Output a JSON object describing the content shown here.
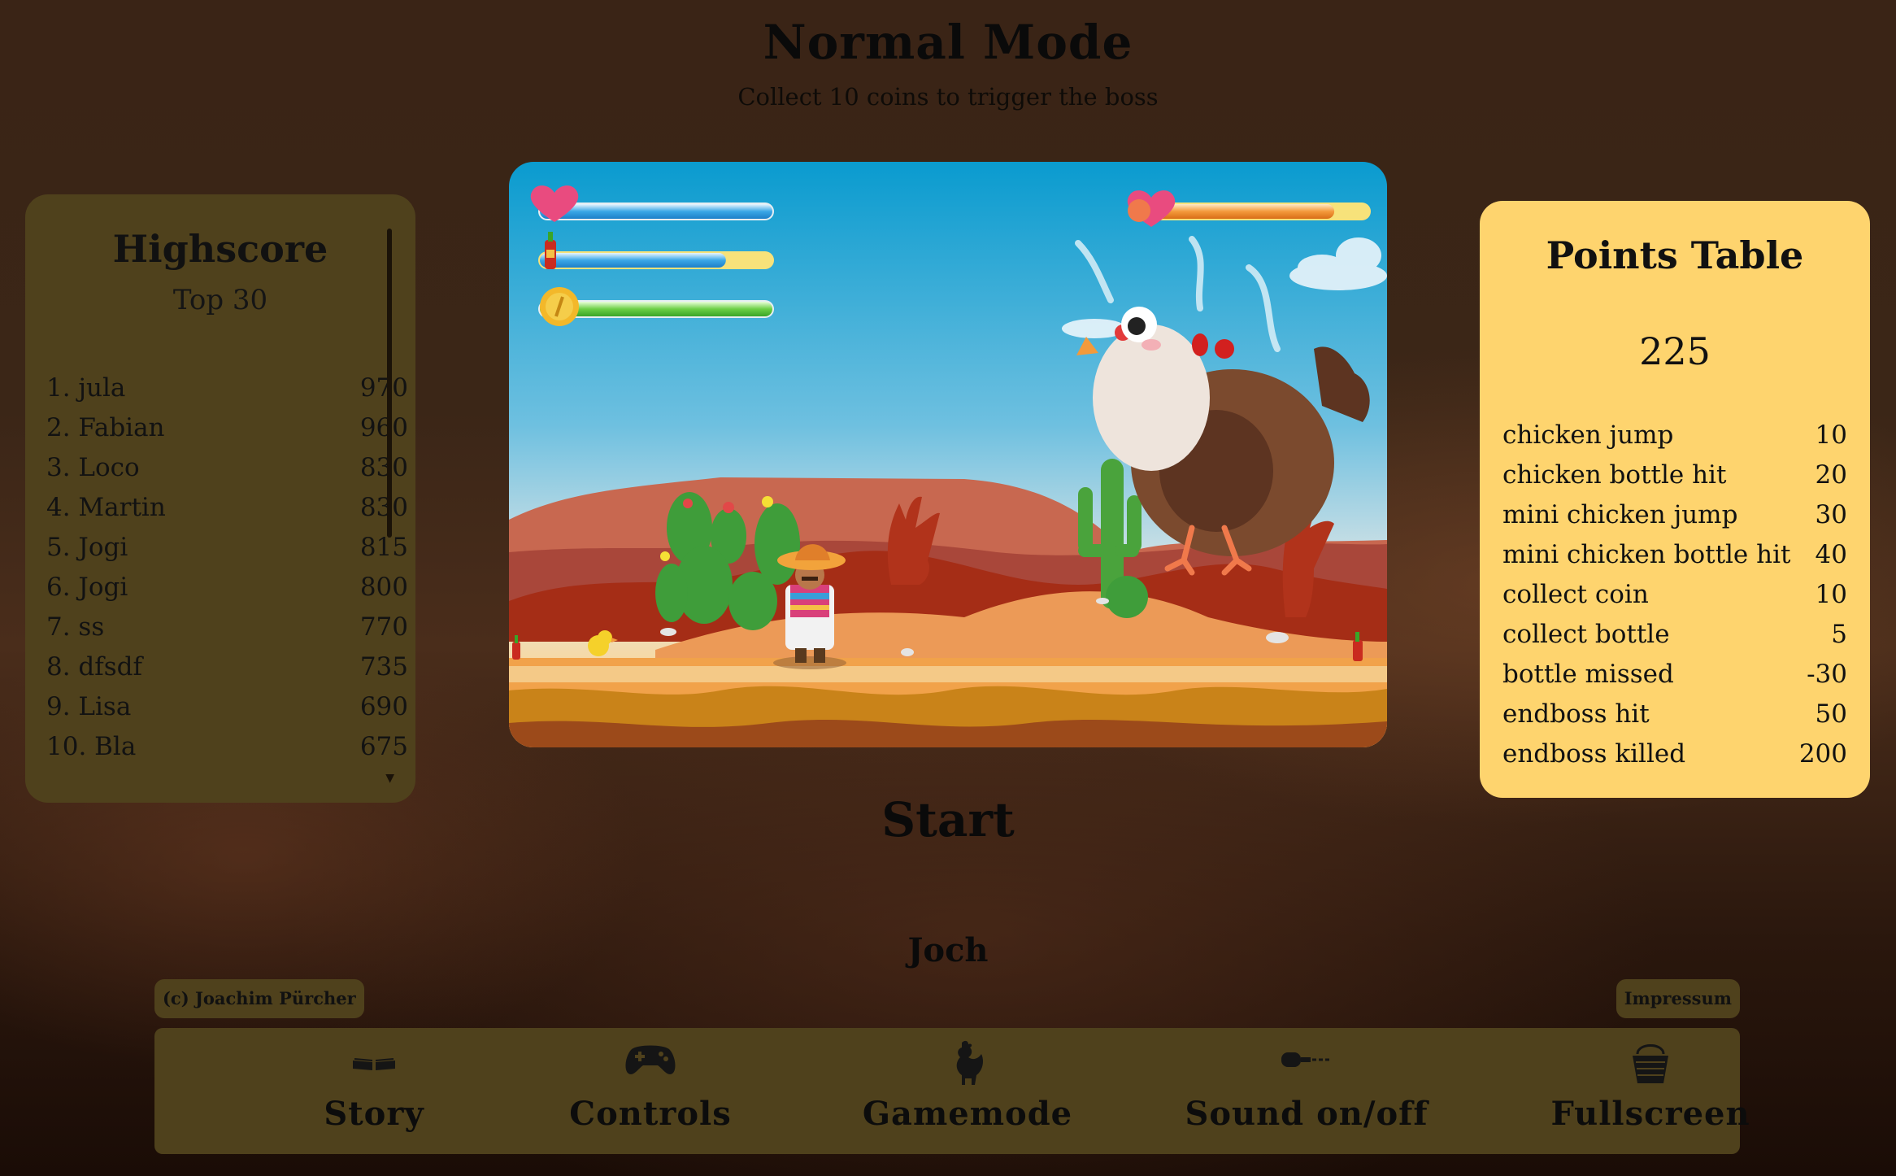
{
  "page": {
    "title": "Normal Mode",
    "subtitle": "Collect 10 coins to trigger the boss",
    "start_label": "Start",
    "player_name": "Joch",
    "copyright": "(c) Joachim Pürcher",
    "impressum": "Impressum"
  },
  "highscore": {
    "title": "Highscore",
    "subtitle": "Top 30",
    "entries": [
      {
        "rank": "1. jula",
        "score": "970"
      },
      {
        "rank": "2. Fabian",
        "score": "960"
      },
      {
        "rank": "3. Loco",
        "score": "830"
      },
      {
        "rank": "4. Martin",
        "score": "830"
      },
      {
        "rank": "5. Jogi",
        "score": "815"
      },
      {
        "rank": "6. Jogi",
        "score": "800"
      },
      {
        "rank": "7. ss",
        "score": "770"
      },
      {
        "rank": "8. dfsdf",
        "score": "735"
      },
      {
        "rank": "9. Lisa",
        "score": "690"
      },
      {
        "rank": "10. Bla",
        "score": "675"
      }
    ]
  },
  "points_table": {
    "title": "Points Table",
    "current_score": "225",
    "rows": [
      {
        "label": "chicken jump",
        "points": "10"
      },
      {
        "label": "chicken bottle hit",
        "points": "20"
      },
      {
        "label": "mini chicken jump",
        "points": "30"
      },
      {
        "label": "mini chicken bottle hit",
        "points": "40"
      },
      {
        "label": "collect coin",
        "points": "10"
      },
      {
        "label": "collect bottle",
        "points": "5"
      },
      {
        "label": "bottle missed",
        "points": "-30"
      },
      {
        "label": "endboss hit",
        "points": "50"
      },
      {
        "label": "endboss killed",
        "points": "200"
      }
    ]
  },
  "game": {
    "health_fill": 1.0,
    "bottle_fill": 0.8,
    "coin_fill": 1.0,
    "boss_health_fill": 0.85
  },
  "menu": {
    "items": [
      {
        "label": "Story",
        "icon": "book-icon"
      },
      {
        "label": "Controls",
        "icon": "gamepad-icon"
      },
      {
        "label": "Gamemode",
        "icon": "rooster-icon"
      },
      {
        "label": "Sound on/off",
        "icon": "microphone-icon"
      },
      {
        "label": "Fullscreen",
        "icon": "basket-icon"
      }
    ]
  },
  "colors": {
    "panel": "#4f411c",
    "points_panel": "#fed46e",
    "sky_top": "#0a9bcf",
    "ground": "#f1a24a"
  }
}
